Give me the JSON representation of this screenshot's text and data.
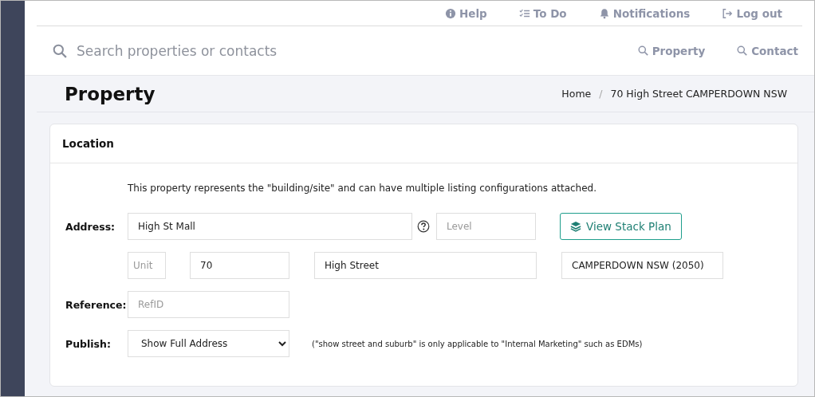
{
  "top_links": [
    {
      "kind": "info",
      "label": "Help"
    },
    {
      "kind": "checklist",
      "label": "To Do"
    },
    {
      "kind": "bell",
      "label": "Notifications"
    },
    {
      "kind": "logout",
      "label": "Log out"
    }
  ],
  "search": {
    "placeholder": "Search properties or contacts"
  },
  "search_links": [
    {
      "label": "Property"
    },
    {
      "label": "Contact"
    }
  ],
  "page_title": "Property",
  "breadcrumb": [
    "Home",
    "70 High Street CAMPERDOWN NSW"
  ],
  "breadcrumb_separator": "/",
  "card": {
    "title": "Location",
    "note": "This property represents the \"building/site\" and can have multiple listing configurations attached.",
    "address": {
      "label": "Address:",
      "building": "High St Mall",
      "level_placeholder": "Level",
      "button": "View Stack Plan",
      "unit_placeholder": "Unit",
      "number": "70",
      "street": "High Street",
      "suburb": "CAMPERDOWN NSW (2050)"
    },
    "reference": {
      "label": "Reference:",
      "placeholder": "RefID"
    },
    "publish": {
      "label": "Publish:",
      "value": "Show Full Address",
      "hint": "(\"show street and suburb\" is only applicable to \"Internal Marketing\" such as EDMs)"
    }
  }
}
